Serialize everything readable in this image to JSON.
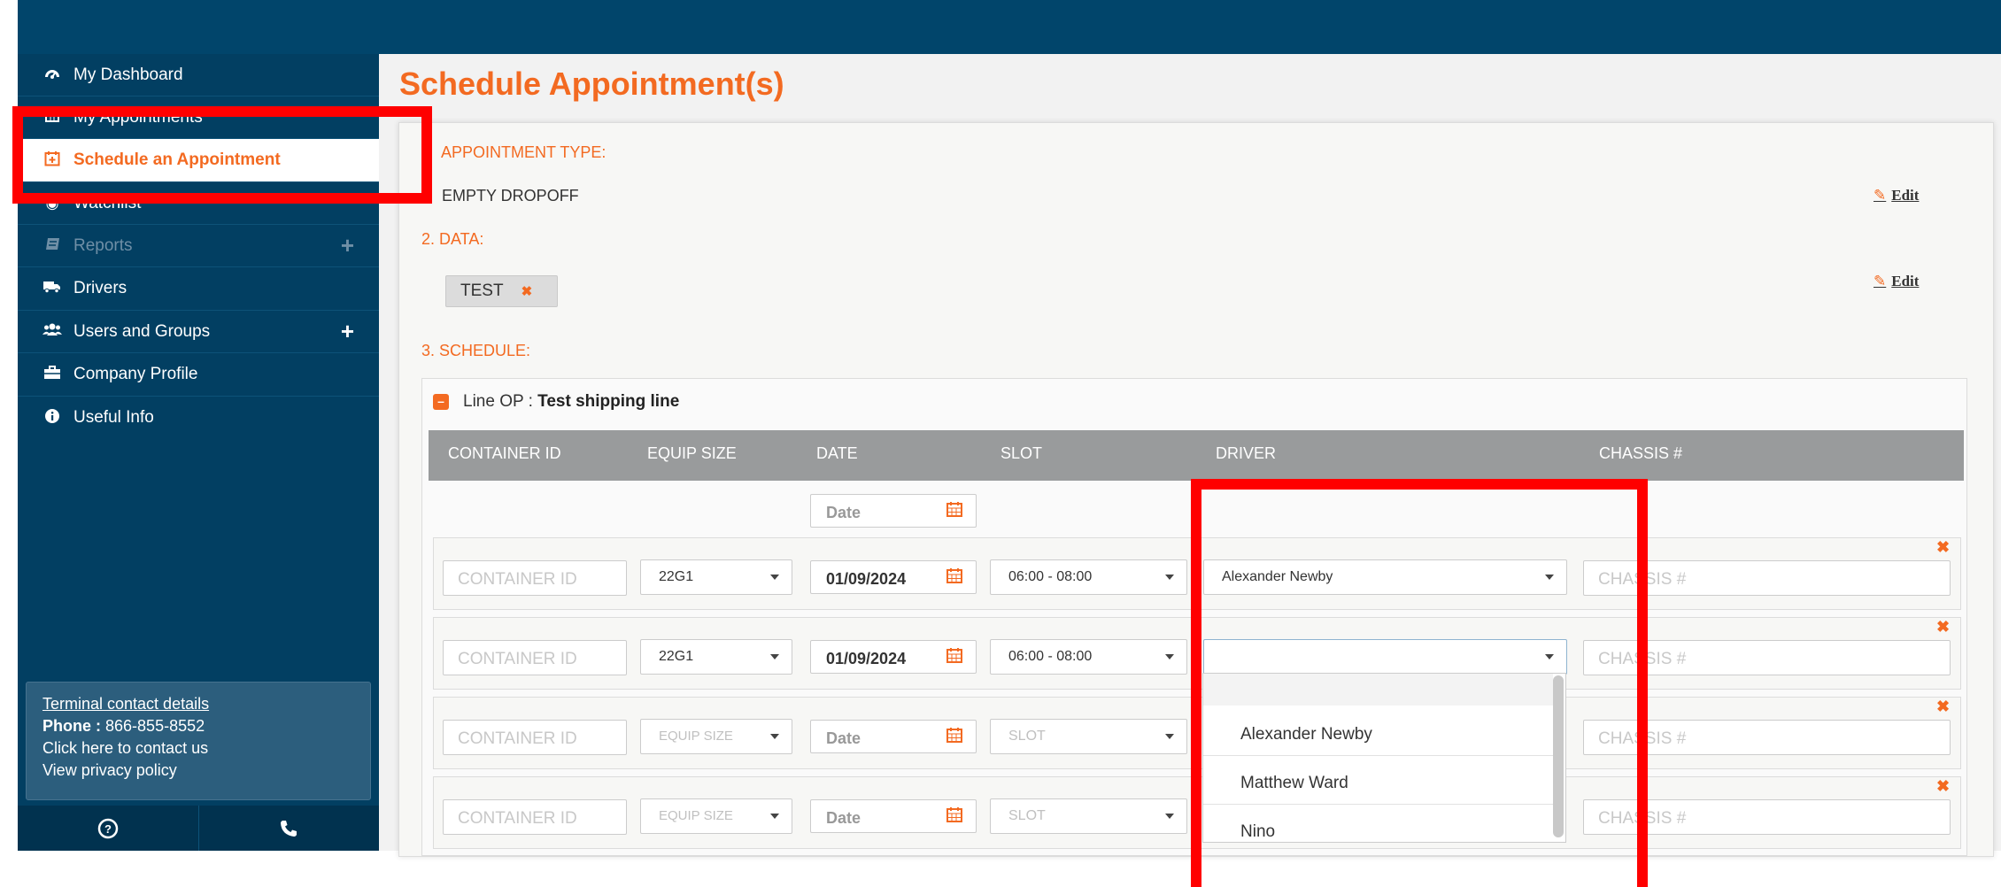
{
  "sidebar": {
    "items": [
      {
        "label": "My Dashboard",
        "icon": "dashboard-icon"
      },
      {
        "label": "My Appointments",
        "icon": "calendar-grid-icon"
      },
      {
        "label": "Schedule an Appointment",
        "icon": "calendar-plus-icon",
        "state": "active"
      },
      {
        "label": "Watchlist",
        "icon": "eye-icon"
      },
      {
        "label": "Reports",
        "icon": "book-icon",
        "state": "disabled",
        "expand": "+"
      },
      {
        "label": "Drivers",
        "icon": "truck-icon"
      },
      {
        "label": "Users and Groups",
        "icon": "users-icon",
        "expand": "+"
      },
      {
        "label": "Company Profile",
        "icon": "briefcase-icon"
      },
      {
        "label": "Useful Info",
        "icon": "info-icon"
      }
    ],
    "contact": {
      "heading": "Terminal contact details",
      "phone_label": "Phone :",
      "phone": "866-855-8552",
      "contact_link": "Click here to contact us",
      "privacy_link": "View privacy policy"
    },
    "bottom_icons": [
      "help-icon",
      "phone-icon"
    ]
  },
  "page": {
    "title": "Schedule Appointment(s)",
    "appointment_type_label": "APPOINTMENT TYPE:",
    "appointment_type_value": "EMPTY DROPOFF",
    "data_label": "2. DATA:",
    "data_tag": "TEST",
    "schedule_label": "3. SCHEDULE:",
    "edit_label": "Edit",
    "line_op_label": "Line OP :",
    "line_op_value": "Test shipping line"
  },
  "table": {
    "headers": [
      "CONTAINER ID",
      "EQUIP SIZE",
      "DATE",
      "SLOT",
      "DRIVER",
      "CHASSIS #"
    ],
    "date_filter_placeholder": "Date",
    "rows": [
      {
        "container_placeholder": "CONTAINER ID",
        "equip": "22G1",
        "date": "01/09/2024",
        "slot": "06:00 - 08:00",
        "driver": "Alexander Newby",
        "chassis_placeholder": "CHASSIS #"
      },
      {
        "container_placeholder": "CONTAINER ID",
        "equip": "22G1",
        "date": "01/09/2024",
        "slot": "06:00 - 08:00",
        "driver": "",
        "chassis_placeholder": "CHASSIS #"
      },
      {
        "container_placeholder": "CONTAINER ID",
        "equip": "EQUIP SIZE",
        "date": "Date",
        "slot": "SLOT",
        "driver": "",
        "chassis_placeholder": "CHASSIS #"
      },
      {
        "container_placeholder": "CONTAINER ID",
        "equip": "EQUIP SIZE",
        "date": "Date",
        "slot": "SLOT",
        "driver": "",
        "chassis_placeholder": "CHASSIS #"
      }
    ]
  },
  "driver_dropdown": {
    "options": [
      "",
      "Alexander Newby",
      "Matthew Ward",
      "Nino"
    ]
  },
  "colors": {
    "accent": "#f36a21",
    "sidebar": "#023f62",
    "header_bar": "#01456b",
    "table_header": "#999b9c",
    "highlight_box": "#ff0000"
  }
}
